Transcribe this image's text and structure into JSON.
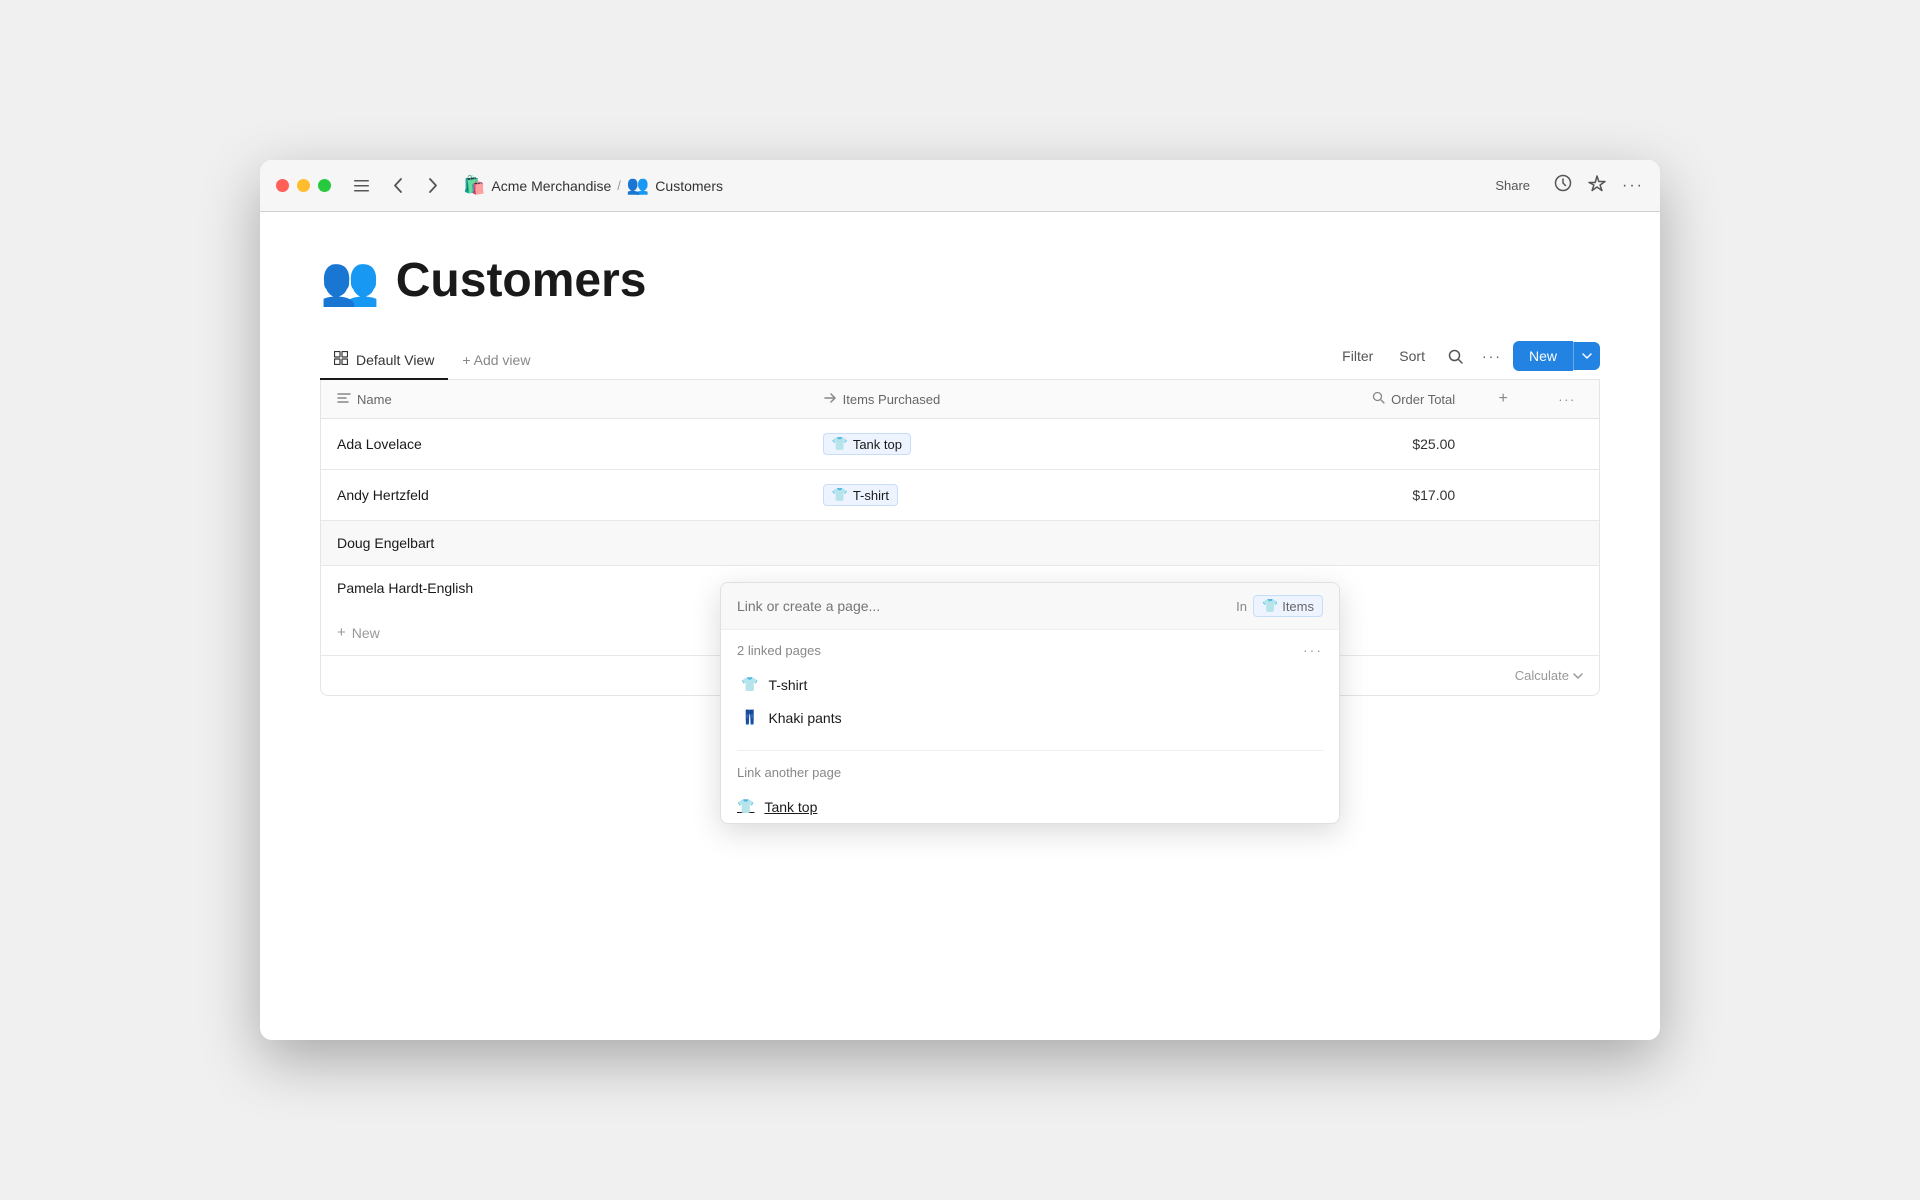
{
  "window": {
    "title": "Acme Merchandise",
    "breadcrumb": {
      "app_icon": "🛍️",
      "app_name": "Acme Merchandise",
      "separator": "/",
      "page_icon": "👥",
      "page_name": "Customers"
    },
    "titlebar_right": {
      "share_label": "Share",
      "history_icon": "history-icon",
      "star_icon": "star-icon",
      "more_icon": "more-icon"
    }
  },
  "page": {
    "icon": "👥",
    "title": "Customers"
  },
  "toolbar": {
    "view_tab": {
      "icon": "grid-icon",
      "label": "Default View"
    },
    "add_view_label": "+ Add view",
    "filter_label": "Filter",
    "sort_label": "Sort",
    "search_icon": "search-icon",
    "more_icon": "more-icon",
    "new_label": "New",
    "chevron_icon": "chevron-down-icon"
  },
  "table": {
    "columns": [
      {
        "id": "name",
        "icon": "text-icon",
        "label": "Name"
      },
      {
        "id": "items",
        "icon": "relation-icon",
        "label": "Items Purchased"
      },
      {
        "id": "total",
        "icon": "search-icon",
        "label": "Order Total"
      }
    ],
    "rows": [
      {
        "id": "row1",
        "name": "Ada Lovelace",
        "items": [
          {
            "icon": "👕",
            "label": "Tank top"
          }
        ],
        "total": "$25.00"
      },
      {
        "id": "row2",
        "name": "Andy Hertzfeld",
        "items": [
          {
            "icon": "👕",
            "label": "T-shirt"
          }
        ],
        "total": "$17.00"
      },
      {
        "id": "row3",
        "name": "Doug Engelbart",
        "items": [],
        "total": ""
      },
      {
        "id": "row4",
        "name": "Pamela Hardt-English",
        "items": [],
        "total": ""
      }
    ],
    "new_row_label": "New",
    "calculate_label": "Calculate",
    "calculate_icon": "chevron-down-icon"
  },
  "dropdown": {
    "search_placeholder": "Link or create a page...",
    "in_label": "In",
    "in_badge_icon": "👕",
    "in_badge_label": "Items",
    "linked_pages_section": {
      "title": "2 linked pages",
      "more_icon": "more-icon",
      "items": [
        {
          "icon": "👕",
          "label": "T-shirt"
        },
        {
          "icon": "👖",
          "label": "Khaki pants"
        }
      ]
    },
    "link_another_label": "Link another page",
    "link_another_items": [
      {
        "icon": "👕",
        "label": "Tank top"
      }
    ]
  }
}
